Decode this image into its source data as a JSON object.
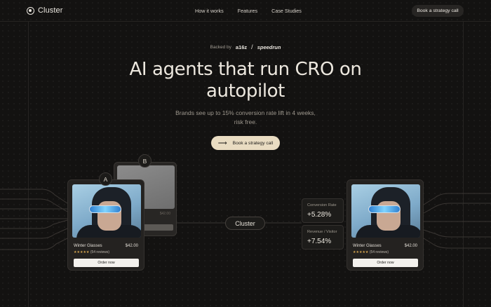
{
  "brand": {
    "name": "Cluster"
  },
  "nav": {
    "items": [
      "How it works",
      "Features",
      "Case Studies"
    ],
    "cta": "Book a strategy call"
  },
  "hero": {
    "backed_by": "Backed by",
    "investor_1": "a16z",
    "investor_2": "speedrun",
    "title_line_1": "AI agents that run CRO on",
    "title_line_2": "autopilot",
    "subtitle_line_1": "Brands see up to 15% conversion rate lift in 4 weeks,",
    "subtitle_line_2": "risk free.",
    "cta": "Book a strategy call"
  },
  "demo": {
    "variant_a": "A",
    "variant_b": "B",
    "hub_label": "Cluster",
    "product": {
      "name": "Winter Glasses",
      "price": "$42.00",
      "stars": "★★★★★",
      "reviews": "(54 reviews)",
      "button": "Order now"
    },
    "variant_b_price": "$42.00",
    "metrics": [
      {
        "label": "Conversion Rate",
        "value": "+5.28%"
      },
      {
        "label": "Revenue / Visitor",
        "value": "+7.54%"
      }
    ]
  },
  "colors": {
    "background": "#131211",
    "cta_accent": "#e9dcc2",
    "text": "#ece7de"
  }
}
